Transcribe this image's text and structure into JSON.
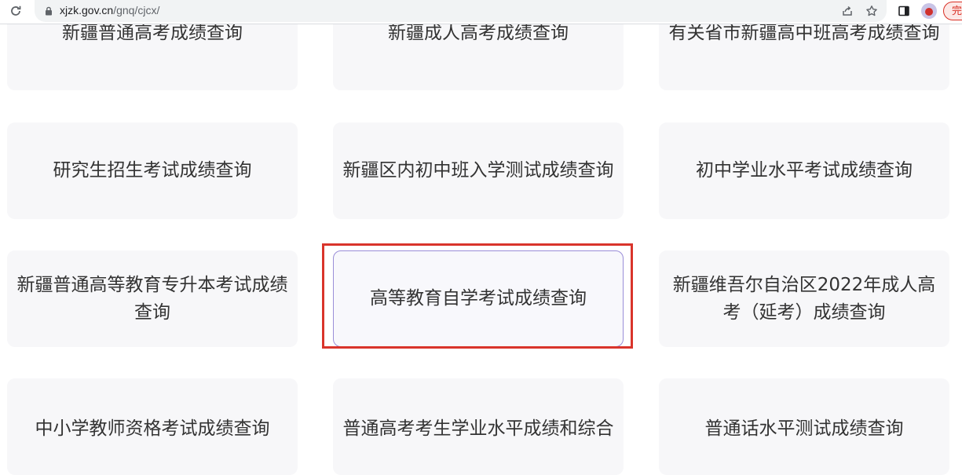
{
  "browser": {
    "url_host": "xjzk.gov.cn",
    "url_path": "/gnq/cjcx/",
    "update_chip_label": "完"
  },
  "cards": {
    "r0c1": "新疆普通高考成绩查询",
    "r0c2": "新疆成人高考成绩查询",
    "r0c3": "有关省市新疆高中班高考成绩查询",
    "r1c1": "研究生招生考试成绩查询",
    "r1c2": "新疆区内初中班入学测试成绩查询",
    "r1c3": "初中学业水平考试成绩查询",
    "r2c1": "新疆普通高等教育专升本考试成绩查询",
    "r2c2": "高等教育自学考试成绩查询",
    "r2c3": "新疆维吾尔自治区2022年成人高考（延考）成绩查询",
    "r3c1": "中小学教师资格考试成绩查询",
    "r3c2": "普通高考考生学业水平成绩和综合",
    "r3c3": "普通话水平测试成绩查询"
  },
  "colors": {
    "highlight": "#d9342b",
    "hover_border": "#9a8ed8"
  }
}
